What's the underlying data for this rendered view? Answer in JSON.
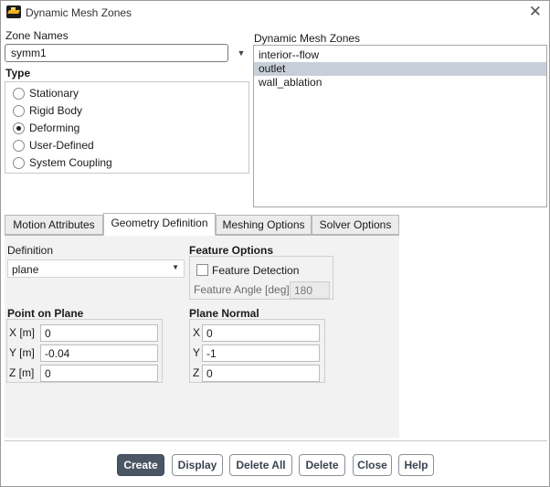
{
  "window": {
    "title": "Dynamic Mesh Zones",
    "close_glyph": "✕",
    "app_icon": "app-logo-icon"
  },
  "zone_names": {
    "label": "Zone Names",
    "selected": "symm1",
    "arrow_glyph": "▼"
  },
  "type": {
    "label": "Type",
    "options": [
      {
        "label": "Stationary",
        "checked": false
      },
      {
        "label": "Rigid Body",
        "checked": false
      },
      {
        "label": "Deforming",
        "checked": true
      },
      {
        "label": "User-Defined",
        "checked": false
      },
      {
        "label": "System Coupling",
        "checked": false
      }
    ]
  },
  "dynamic_mesh_zones": {
    "label": "Dynamic Mesh Zones",
    "items": [
      {
        "label": "interior--flow",
        "selected": false
      },
      {
        "label": "outlet",
        "selected": true
      },
      {
        "label": "wall_ablation",
        "selected": false
      }
    ]
  },
  "tabs": [
    {
      "label": "Motion Attributes",
      "active": false
    },
    {
      "label": "Geometry Definition",
      "active": true
    },
    {
      "label": "Meshing Options",
      "active": false
    },
    {
      "label": "Solver Options",
      "active": false
    }
  ],
  "definition": {
    "label": "Definition",
    "value": "plane",
    "arrow_glyph": "▼"
  },
  "feature_options": {
    "label": "Feature Options",
    "detection_label": "Feature Detection",
    "detection_checked": false,
    "angle_label": "Feature Angle [deg]",
    "angle_value": "180"
  },
  "point_on_plane": {
    "label": "Point on Plane",
    "x_label": "X [m]",
    "x_value": "0",
    "y_label": "Y [m]",
    "y_value": "-0.04",
    "z_label": "Z [m]",
    "z_value": "0"
  },
  "plane_normal": {
    "label": "Plane Normal",
    "x_label": "X",
    "x_value": "0",
    "y_label": "Y",
    "y_value": "-1",
    "z_label": "Z",
    "z_value": "0"
  },
  "buttons": {
    "create": "Create",
    "display": "Display",
    "delete_all": "Delete All",
    "delete": "Delete",
    "close": "Close",
    "help": "Help"
  },
  "colors": {
    "primary_button": "#4a5664",
    "selected_row": "#c7cfd8",
    "panel_bg": "#f2f2f2"
  }
}
